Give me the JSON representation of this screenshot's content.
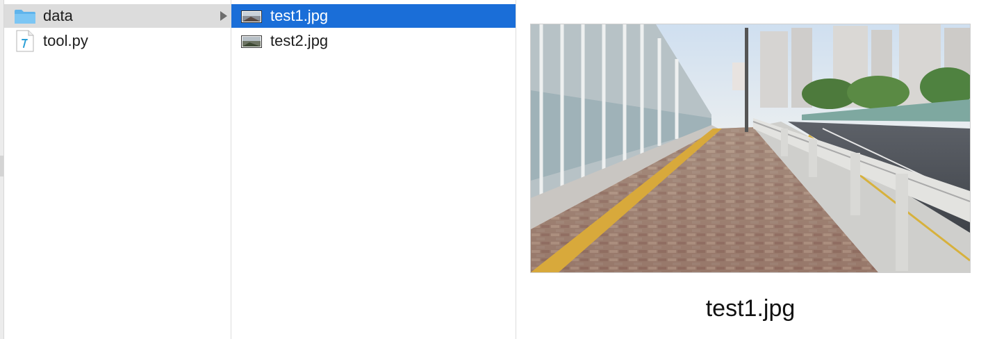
{
  "columns": {
    "first": {
      "items": [
        {
          "label": "data",
          "icon": "folder-icon",
          "selected": "inactive",
          "has_children": true
        },
        {
          "label": "tool.py",
          "icon": "python-file-icon",
          "selected": "none",
          "has_children": false
        }
      ]
    },
    "second": {
      "items": [
        {
          "label": "test1.jpg",
          "icon": "image-thumbnail-icon",
          "selected": "active"
        },
        {
          "label": "test2.jpg",
          "icon": "image-thumbnail-icon",
          "selected": "none"
        }
      ]
    }
  },
  "preview": {
    "file_name": "test1.jpg",
    "image_description_icon": "sidewalk-photo"
  },
  "colors": {
    "selection_active": "#1a6ed8",
    "selection_inactive": "#dcdcdc",
    "folder_blue": "#5fb4ec",
    "python_accent": "#2a9fd6"
  }
}
